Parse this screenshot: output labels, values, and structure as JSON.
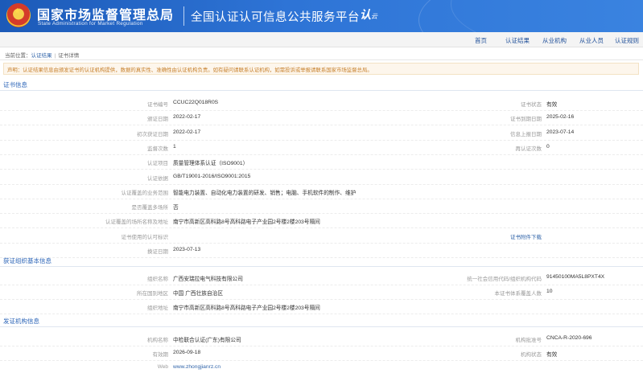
{
  "header": {
    "org_cn": "国家市场监督管理总局",
    "org_en": "State Administration  for  Market Regulation",
    "platform": "全国认证认可信息公共服务平台",
    "logo_main": "认",
    "logo_sub": "云"
  },
  "nav": [
    "首页",
    "认证结果",
    "从业机构",
    "从业人员",
    "认证规则"
  ],
  "breadcrumb": {
    "current": "当前位置：",
    "link": "认证结果",
    "page": "证书详情"
  },
  "notice": "声明：认证结果信息由颁发证书的认证机构提供，数据的真实性、准确性由认证机构负责。如有疑问请联系认证机构，如需投诉或举报请联系国家市场监督总局。",
  "sections": {
    "cert": {
      "title": "证书信息",
      "rows": [
        {
          "l1": "证书编号",
          "v1": "CCUC22Q018R0S",
          "l2": "证书状态",
          "v2": "有效"
        },
        {
          "l1": "颁证日期",
          "v1": "2022-02-17",
          "l2": "证书到期日期",
          "v2": "2025-02-16"
        },
        {
          "l1": "初次获证日期",
          "v1": "2022-02-17",
          "l2": "信息上报日期",
          "v2": "2023-07-14"
        },
        {
          "l1": "监督次数",
          "v1": "1",
          "l2": "再认证次数",
          "v2": "0"
        },
        {
          "l1": "认证项目",
          "v1": "质量管理体系认证（ISO9001）",
          "l2": "",
          "v2": ""
        },
        {
          "l1": "认证依据",
          "v1": "GB/T19001-2016/ISO9001:2015",
          "l2": "",
          "v2": ""
        },
        {
          "l1": "认证覆盖的业务范围",
          "v1": "智能电力装置、自动化电力装置的研发、销售；电脑、手机软件的制作、维护",
          "l2": "",
          "v2": ""
        },
        {
          "l1": "是否覆盖多场所",
          "v1": "否",
          "l2": "",
          "v2": ""
        },
        {
          "l1": "认证覆盖的场所名称及地址",
          "v1": "南宁市高新区高科路8号高科路电子产业园2号楼2楼203号隔间",
          "l2": "",
          "v2": ""
        },
        {
          "l1": "证书使用的认可标识",
          "v1": "",
          "l2": "证书附件下载",
          "v2": ""
        },
        {
          "l1": "换证日期",
          "v1": "2023-07-13",
          "l2": "",
          "v2": ""
        }
      ]
    },
    "org": {
      "title": "获证组织基本信息",
      "rows": [
        {
          "l1": "组织名称",
          "v1": "广西安瑞拉电气科技有限公司",
          "l2": "统一社会信用代码/组织机构代码",
          "v2": "91450100MA5L8PXT4X"
        },
        {
          "l1": "所在国别地区",
          "v1": "中国 广西壮族自治区",
          "l2": "本证书体系覆盖人数",
          "v2": "10"
        },
        {
          "l1": "组织地址",
          "v1": "南宁市高新区高科路8号高科路电子产业园2号楼2楼203号隔间",
          "l2": "",
          "v2": ""
        }
      ]
    },
    "agency": {
      "title": "发证机构信息",
      "rows": [
        {
          "l1": "机构名称",
          "v1": "中检联合认证(广东)有限公司",
          "l2": "机构批准号",
          "v2": "CNCA-R-2020-696"
        },
        {
          "l1": "有效期",
          "v1": "2026-09-18",
          "l2": "机构状态",
          "v2": "有效"
        },
        {
          "l1": "Web",
          "v1": "www.zhongjianrz.cn",
          "l2": "",
          "v2": ""
        }
      ]
    }
  }
}
